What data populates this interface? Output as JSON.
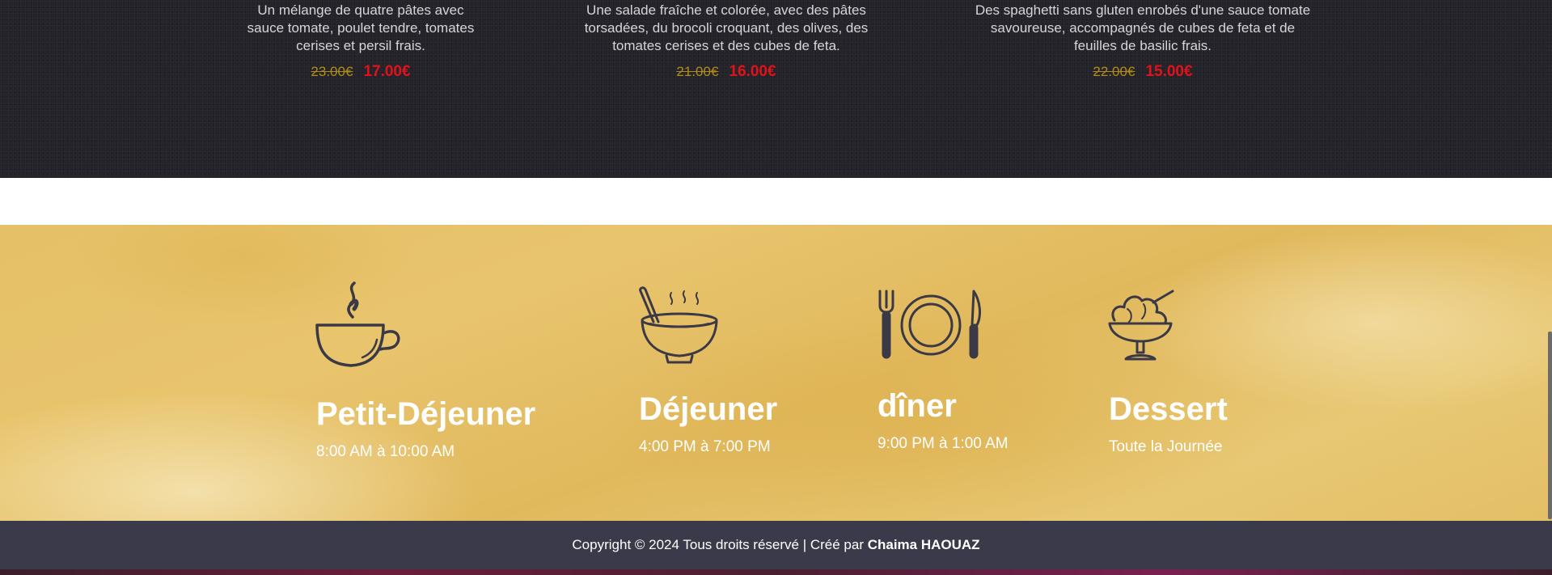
{
  "menu": {
    "items": [
      {
        "description": "Un mélange de quatre pâtes avec sauce tomate, poulet tendre, tomates cerises et persil frais.",
        "old_price": "23.00€",
        "new_price": "17.00€"
      },
      {
        "description": "Une salade fraîche et colorée, avec des pâtes torsadées, du brocoli croquant, des olives, des tomates cerises et des cubes de feta.",
        "old_price": "21.00€",
        "new_price": "16.00€"
      },
      {
        "description": "Des spaghetti sans gluten enrobés d'une sauce tomate savoureuse, accompagnés de cubes de feta et de feuilles de basilic frais.",
        "old_price": "22.00€",
        "new_price": "15.00€"
      }
    ]
  },
  "hours": [
    {
      "icon": "coffee-cup-icon",
      "title": "Petit-Déjeuner",
      "time": "8:00 AM à 10:00 AM"
    },
    {
      "icon": "soup-bowl-icon",
      "title": "Déjeuner",
      "time": "4:00 PM à 7:00 PM"
    },
    {
      "icon": "plate-cutlery-icon",
      "title": "dîner",
      "time": "9:00 PM à 1:00 AM"
    },
    {
      "icon": "ice-cream-icon",
      "title": "Dessert",
      "time": "Toute la Journée"
    }
  ],
  "footer": {
    "text": "Copyright © 2024 Tous droits réservé | Créé par",
    "author": "Chaima HAOUAZ"
  },
  "colors": {
    "dark_bg": "#242329",
    "accent_red": "#e0131a",
    "old_price_gold": "#b08d1a",
    "hours_bg": "#e5c066",
    "footer_bg": "#3b3a4a",
    "icon_stroke": "#3a3945"
  }
}
